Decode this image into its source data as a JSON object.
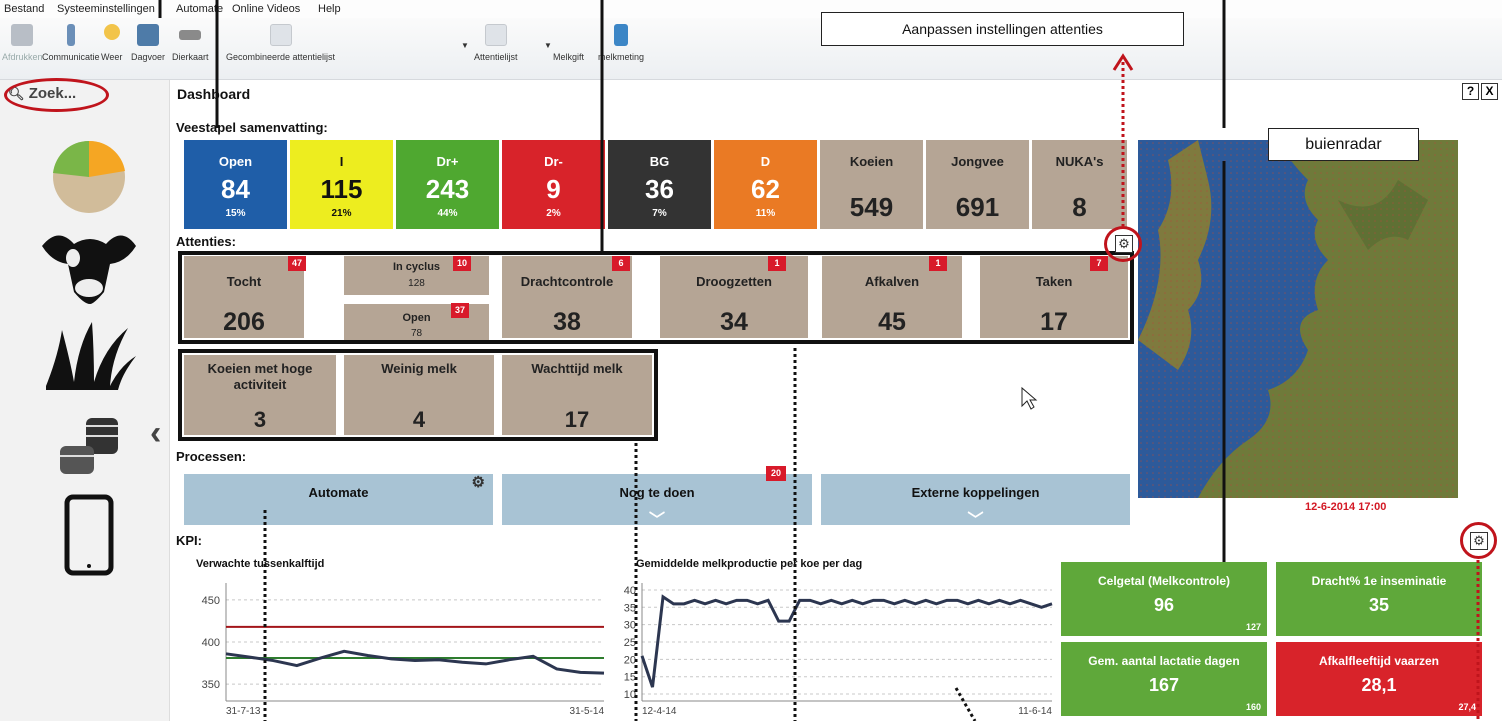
{
  "menu": [
    "Bestand",
    "Systeeminstellingen",
    "Automate",
    "Online Videos",
    "Help"
  ],
  "toolbar": {
    "print": "Afdrukken",
    "communicatie": "Communicatie",
    "weer": "Weer",
    "dagvoer": "Dagvoer",
    "dierkaart": "Dierkaart",
    "gecombineerd": "Gecombineerde attentielijst",
    "attentielijst": "Attentielijst",
    "melkgift": "Melkgift",
    "melkmeting": "melkmeting"
  },
  "search": {
    "label": "Zoek..."
  },
  "dashboard": {
    "title": "Dashboard",
    "help": "?",
    "close": "X"
  },
  "veestapel": {
    "heading": "Veestapel samenvatting:",
    "tiles": [
      {
        "label": "Open",
        "value": "84",
        "pct": "15%",
        "color": "#1f5ea8"
      },
      {
        "label": "I",
        "value": "115",
        "pct": "21%",
        "color": "#eded1f"
      },
      {
        "label": "Dr+",
        "value": "243",
        "pct": "44%",
        "color": "#4fa830"
      },
      {
        "label": "Dr-",
        "value": "9",
        "pct": "2%",
        "color": "#d8232a"
      },
      {
        "label": "BG",
        "value": "36",
        "pct": "7%",
        "color": "#333333"
      },
      {
        "label": "D",
        "value": "62",
        "pct": "11%",
        "color": "#ea7a24"
      },
      {
        "label": "Koeien",
        "value": "549"
      },
      {
        "label": "Jongvee",
        "value": "691"
      },
      {
        "label": "NUKA's",
        "value": "8"
      }
    ]
  },
  "attenties": {
    "heading": "Attenties:",
    "tocht": {
      "label": "Tocht",
      "value": "206",
      "badge": "47"
    },
    "in_cyclus": {
      "label": "In cyclus",
      "value": "128",
      "badge": "10"
    },
    "open": {
      "label": "Open",
      "value": "78",
      "badge": "37"
    },
    "drachtcontrole": {
      "label": "Drachtcontrole",
      "value": "38",
      "badge": "6"
    },
    "droogzetten": {
      "label": "Droogzetten",
      "value": "34",
      "badge": "1"
    },
    "afkalven": {
      "label": "Afkalven",
      "value": "45",
      "badge": "1"
    },
    "taken": {
      "label": "Taken",
      "value": "17",
      "badge": "7"
    },
    "row2": [
      {
        "label": "Koeien met hoge activiteit",
        "value": "3"
      },
      {
        "label": "Weinig melk",
        "value": "4"
      },
      {
        "label": "Wachttijd melk",
        "value": "17"
      }
    ]
  },
  "processen": {
    "heading": "Processen:",
    "items": [
      "Automate",
      "Nog te doen",
      "Externe koppelingen"
    ],
    "badge": "20"
  },
  "callouts": {
    "attenties": "Aanpassen instellingen attenties",
    "radar": "buienradar"
  },
  "map": {
    "timestamp": "12-6-2014 17:00"
  },
  "kpi": {
    "heading": "KPI:",
    "tiles": [
      {
        "label": "Celgetal (Melkcontrole)",
        "value": "96",
        "sub": "127",
        "color": "#5fa83a"
      },
      {
        "label": "Dracht% 1e inseminatie",
        "value": "35",
        "sub": "",
        "color": "#5fa83a"
      },
      {
        "label": "Gem. aantal lactatie dagen",
        "value": "167",
        "sub": "160",
        "color": "#5fa83a"
      },
      {
        "label": "Afkalfleeftijd vaarzen",
        "value": "28,1",
        "sub": "27,4",
        "color": "#d8232a"
      }
    ]
  },
  "chart_data": [
    {
      "type": "line",
      "title": "Verwachte tussenkalftijd",
      "xlabel": "",
      "ylabel": "",
      "x_ticks": [
        "31-7-13",
        "31-5-14"
      ],
      "y_ticks": [
        350,
        400,
        450
      ],
      "ylim": [
        330,
        470
      ],
      "reference_lines": [
        {
          "value": 418,
          "color": "#a3141a"
        },
        {
          "value": 381,
          "color": "#2e7d2e"
        }
      ],
      "series": [
        {
          "values": [
            386,
            382,
            378,
            372,
            381,
            389,
            384,
            380,
            378,
            379,
            376,
            374,
            379,
            383,
            368,
            364,
            363
          ]
        }
      ]
    },
    {
      "type": "line",
      "title": "Gemiddelde melkproductie per koe per dag",
      "xlabel": "",
      "ylabel": "",
      "x_ticks": [
        "12-4-14",
        "11-6-14"
      ],
      "y_ticks": [
        10,
        15,
        20,
        25,
        30,
        35,
        40
      ],
      "ylim": [
        8,
        42
      ],
      "series": [
        {
          "values": [
            21,
            12,
            38,
            36,
            36,
            37,
            36,
            37,
            36,
            37,
            37,
            36,
            37,
            31,
            31,
            37,
            37,
            36,
            37,
            36,
            37,
            36,
            37,
            37,
            36,
            37,
            36,
            37,
            36,
            37,
            37,
            36,
            37,
            36,
            37,
            36,
            37,
            36,
            35,
            36
          ]
        }
      ]
    }
  ]
}
